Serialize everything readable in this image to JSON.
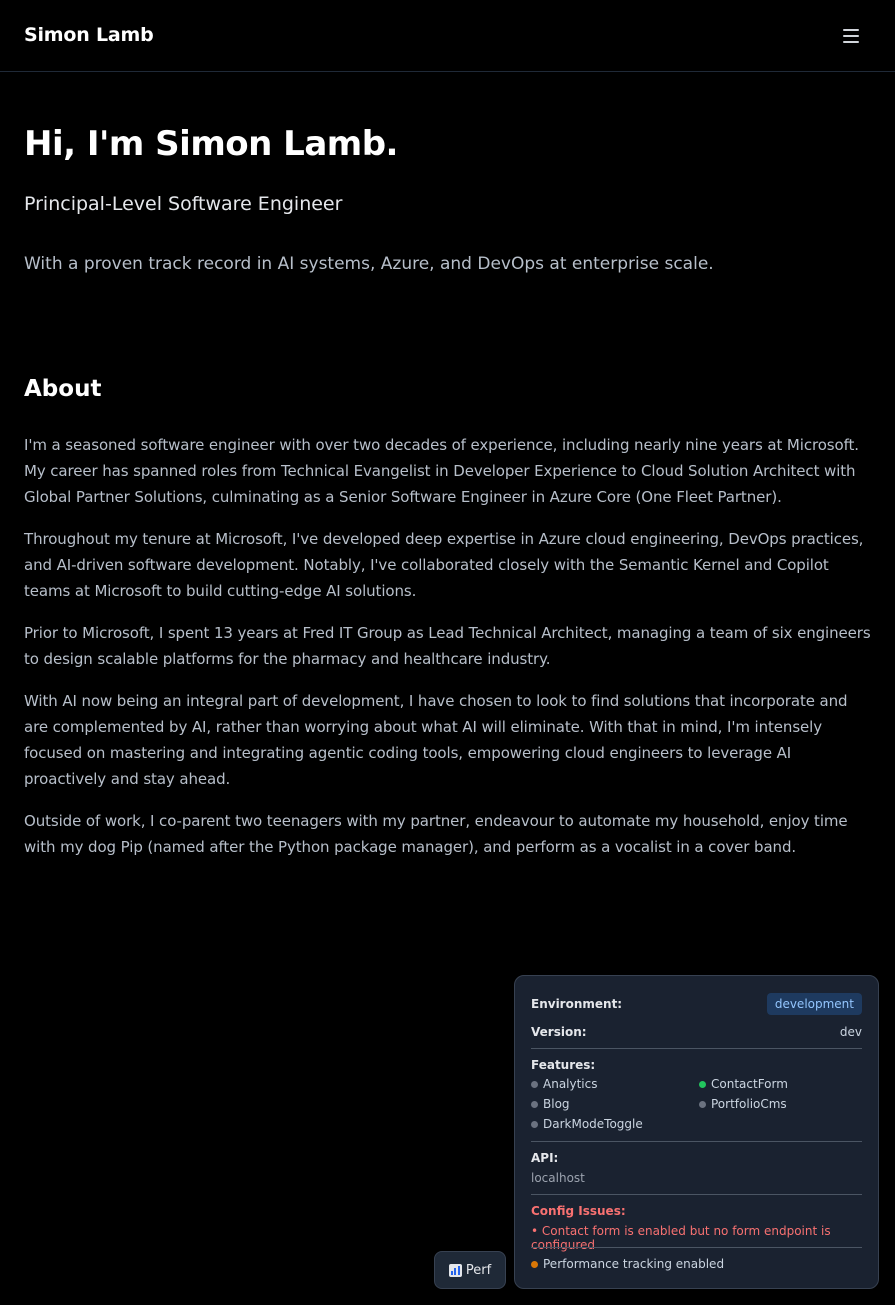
{
  "header": {
    "brand": "Simon Lamb",
    "menu_icon": "hamburger-menu-icon"
  },
  "hero": {
    "title": "Hi, I'm Simon Lamb.",
    "subtitle": "Principal-Level Software Engineer",
    "description": "With a proven track record in AI systems, Azure, and DevOps at enterprise scale."
  },
  "about": {
    "title": "About",
    "paragraphs": [
      "I'm a seasoned software engineer with over two decades of experience, including nearly nine years at Microsoft. My career has spanned roles from Technical Evangelist in Developer Experience to Cloud Solution Architect with Global Partner Solutions, culminating as a Senior Software Engineer in Azure Core (One Fleet Partner).",
      "Throughout my tenure at Microsoft, I've developed deep expertise in Azure cloud engineering, DevOps practices, and AI-driven software development. Notably, I've collaborated closely with the Semantic Kernel and Copilot teams at Microsoft to build cutting-edge AI solutions.",
      "Prior to Microsoft, I spent 13 years at Fred IT Group as Lead Technical Architect, managing a team of six engineers to design scalable platforms for the pharmacy and healthcare industry.",
      "With AI now being an integral part of development, I have chosen to look to find solutions that incorporate and are complemented by AI, rather than worrying about what AI will eliminate. With that in mind, I'm intensely focused on mastering and integrating agentic coding tools, empowering cloud engineers to leverage AI proactively and stay ahead.",
      "Outside of work, I co-parent two teenagers with my partner, endeavour to automate my household, enjoy time with my dog Pip (named after the Python package manager), and perform as a vocalist in a cover band."
    ]
  },
  "perf_button": {
    "label": "Perf",
    "icon": "bar-chart-icon"
  },
  "dev_panel": {
    "environment_label": "Environment:",
    "environment_value": "development",
    "version_label": "Version:",
    "version_value": "dev",
    "features_label": "Features:",
    "features": [
      {
        "name": "Analytics",
        "enabled": false,
        "color": "#6b7280"
      },
      {
        "name": "ContactForm",
        "enabled": true,
        "color": "#22c55e"
      },
      {
        "name": "Blog",
        "enabled": false,
        "color": "#6b7280"
      },
      {
        "name": "PortfolioCms",
        "enabled": false,
        "color": "#6b7280"
      },
      {
        "name": "DarkModeToggle",
        "enabled": false,
        "color": "#6b7280"
      }
    ],
    "api_label": "API:",
    "api_value": "localhost",
    "issues_label": "Config Issues:",
    "issues": [
      "• Contact form is enabled but no form endpoint is configured"
    ],
    "perf_status": "Performance tracking enabled",
    "perf_status_color": "#d97706"
  }
}
